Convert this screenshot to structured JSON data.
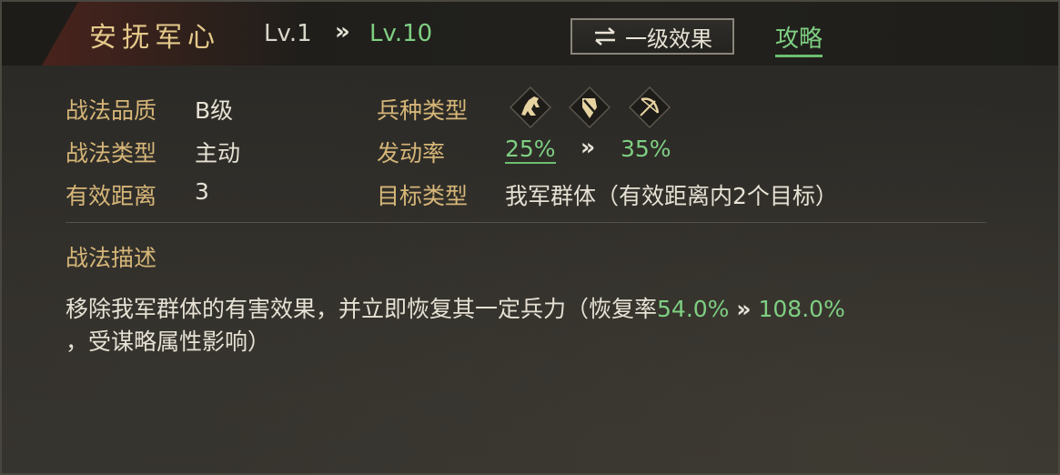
{
  "header": {
    "skill_name": "安抚军心",
    "level_from": "Lv.1",
    "level_arrow": "»",
    "level_to": "Lv.10",
    "toggle_label": "一级效果",
    "toggle_icon": "swap-arrows-icon",
    "strategy_link": "攻略"
  },
  "info": {
    "quality_label": "战法品质",
    "quality_value": "B级",
    "type_label": "战法类型",
    "type_value": "主动",
    "range_label": "有效距离",
    "range_value": "3",
    "troop_label": "兵种类型",
    "troop_icons": [
      "cavalry-icon",
      "shield-infantry-icon",
      "archer-bow-icon"
    ],
    "trigger_label": "发动率",
    "trigger_from": "25%",
    "trigger_arrow": "»",
    "trigger_to": "35%",
    "target_label": "目标类型",
    "target_value": "我军群体（有效距离内2个目标）"
  },
  "description": {
    "title": "战法描述",
    "text_part1": "移除我军群体的有害效果，并立即恢复其一定兵力（恢复率",
    "value_from": "54.0%",
    "arrow": "»",
    "value_to": "108.0%",
    "text_part2": "，受谋略属性影响）"
  },
  "colors": {
    "gold": "#d6b678",
    "title_gold": "#e4c98a",
    "green": "#7fcf82",
    "text": "#e6e1d4"
  }
}
